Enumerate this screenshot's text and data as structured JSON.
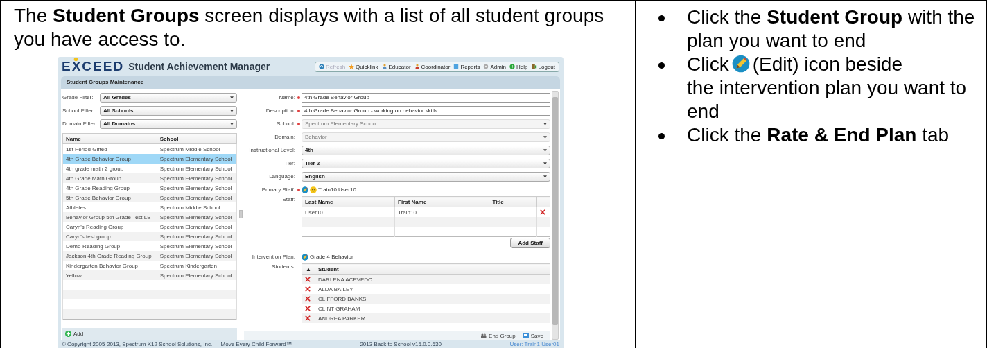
{
  "intro": "The **Student Groups** screen displays with a list of all student groups you have access to.",
  "steps": [
    {
      "kind": "text",
      "text": "Click the **Student Group** with the plan you want to end"
    },
    {
      "kind": "icon",
      "text": "Click",
      "after": "(Edit) icon beside",
      "rest": "the intervention plan you want to end"
    },
    {
      "kind": "text",
      "text": "Click the **Rate & End Plan** tab"
    }
  ],
  "app": {
    "logo": "EXCEED",
    "title": "Student Achievement Manager",
    "nav": [
      {
        "kind": "refresh",
        "label": "Refresh",
        "disabled": true
      },
      {
        "kind": "quicklink",
        "label": "Quicklink",
        "disabled": false
      },
      {
        "kind": "educator",
        "label": "Educator",
        "disabled": false
      },
      {
        "kind": "coordinator",
        "label": "Coordinator",
        "disabled": false
      },
      {
        "kind": "reports",
        "label": "Reports",
        "disabled": false
      },
      {
        "kind": "admin",
        "label": "Admin",
        "disabled": false
      },
      {
        "kind": "help",
        "label": "Help",
        "disabled": false
      },
      {
        "kind": "logout",
        "label": "Logout",
        "disabled": false
      }
    ],
    "panel_title": "Student Groups Maintenance",
    "filters": [
      {
        "label": "Grade Filter:",
        "value": "All Grades"
      },
      {
        "label": "School Filter:",
        "value": "All Schools"
      },
      {
        "label": "Domain Filter:",
        "value": "All Domains"
      }
    ],
    "groups_table": {
      "columns": [
        "Name",
        "School"
      ],
      "rows": [
        {
          "name": "1st Period Gifted",
          "school": "Spectrum Middle School",
          "selected": false
        },
        {
          "name": "4th Grade Behavior Group",
          "school": "Spectrum Elementary School",
          "selected": true
        },
        {
          "name": "4th grade math 2 group",
          "school": "Spectrum Elementary School",
          "selected": false
        },
        {
          "name": "4th Grade Math Group",
          "school": "Spectrum Elementary School",
          "selected": false
        },
        {
          "name": "4th Grade Reading Group",
          "school": "Spectrum Elementary School",
          "selected": false
        },
        {
          "name": "5th Grade Behavior Group",
          "school": "Spectrum Elementary School",
          "selected": false
        },
        {
          "name": "Athletes",
          "school": "Spectrum Middle School",
          "selected": false
        },
        {
          "name": "Behavior Group 5th Grade Test LB",
          "school": "Spectrum Elementary School",
          "selected": false
        },
        {
          "name": "Caryn's Reading Group",
          "school": "Spectrum Elementary School",
          "selected": false
        },
        {
          "name": "Caryn's test group",
          "school": "Spectrum Elementary School",
          "selected": false
        },
        {
          "name": "Demo-Reading Group",
          "school": "Spectrum Elementary School",
          "selected": false
        },
        {
          "name": "Jackson 4th Grade Reading Group",
          "school": "Spectrum Elementary School",
          "selected": false
        },
        {
          "name": "Kindergarten Behavior Group",
          "school": "Spectrum Kindergarten",
          "selected": false
        },
        {
          "name": "Yellow",
          "school": "Spectrum Elementary School",
          "selected": false
        }
      ]
    },
    "add_button": "Add",
    "fields": [
      {
        "kind": "text",
        "label": "Name:",
        "required": true,
        "disabled": false,
        "value": "4th Grade Behavior Group"
      },
      {
        "kind": "text",
        "label": "Description:",
        "required": true,
        "disabled": false,
        "value": "4th Grade Behavior Group - working on behavior skills"
      },
      {
        "kind": "select",
        "label": "School:",
        "required": true,
        "disabled": true,
        "value": "Spectrum Elementary School"
      },
      {
        "kind": "select",
        "label": "Domain:",
        "required": false,
        "disabled": true,
        "value": "Behavior"
      },
      {
        "kind": "select",
        "label": "Instructional Level:",
        "required": false,
        "disabled": false,
        "value": "4th"
      },
      {
        "kind": "select",
        "label": "Tier:",
        "required": false,
        "disabled": false,
        "value": "Tier 2"
      },
      {
        "kind": "select",
        "label": "Language:",
        "required": false,
        "disabled": false,
        "value": "English"
      }
    ],
    "primary_staff": {
      "label": "Primary Staff:",
      "required": true,
      "value": "Train10 User10"
    },
    "staff": {
      "label": "Staff:",
      "columns": [
        "Last Name",
        "First Name",
        "Title"
      ],
      "rows": [
        {
          "last_name": "User10",
          "first_name": "Train10"
        }
      ]
    },
    "add_staff_button": "Add Staff",
    "intervention_plan": {
      "label": "Intervention Plan:",
      "value": "Grade 4 Behavior"
    },
    "students": {
      "label": "Students:",
      "sort": "▲",
      "column": "Student",
      "rows": [
        "DARLENA ACEVEDO",
        "ALDA BAILEY",
        "CLIFFORD BANKS",
        "CLINT GRAHAM",
        "ANDREA PARKER"
      ]
    },
    "footer_buttons": [
      "End Group",
      "Save"
    ],
    "footer": {
      "copyright": "© Copyright 2005-2013, Spectrum K12 School Solutions, Inc. --- Move Every Child Forward™",
      "version": "2013 Back to School v15.0.0.630",
      "user": "User: Train1 User01"
    }
  }
}
